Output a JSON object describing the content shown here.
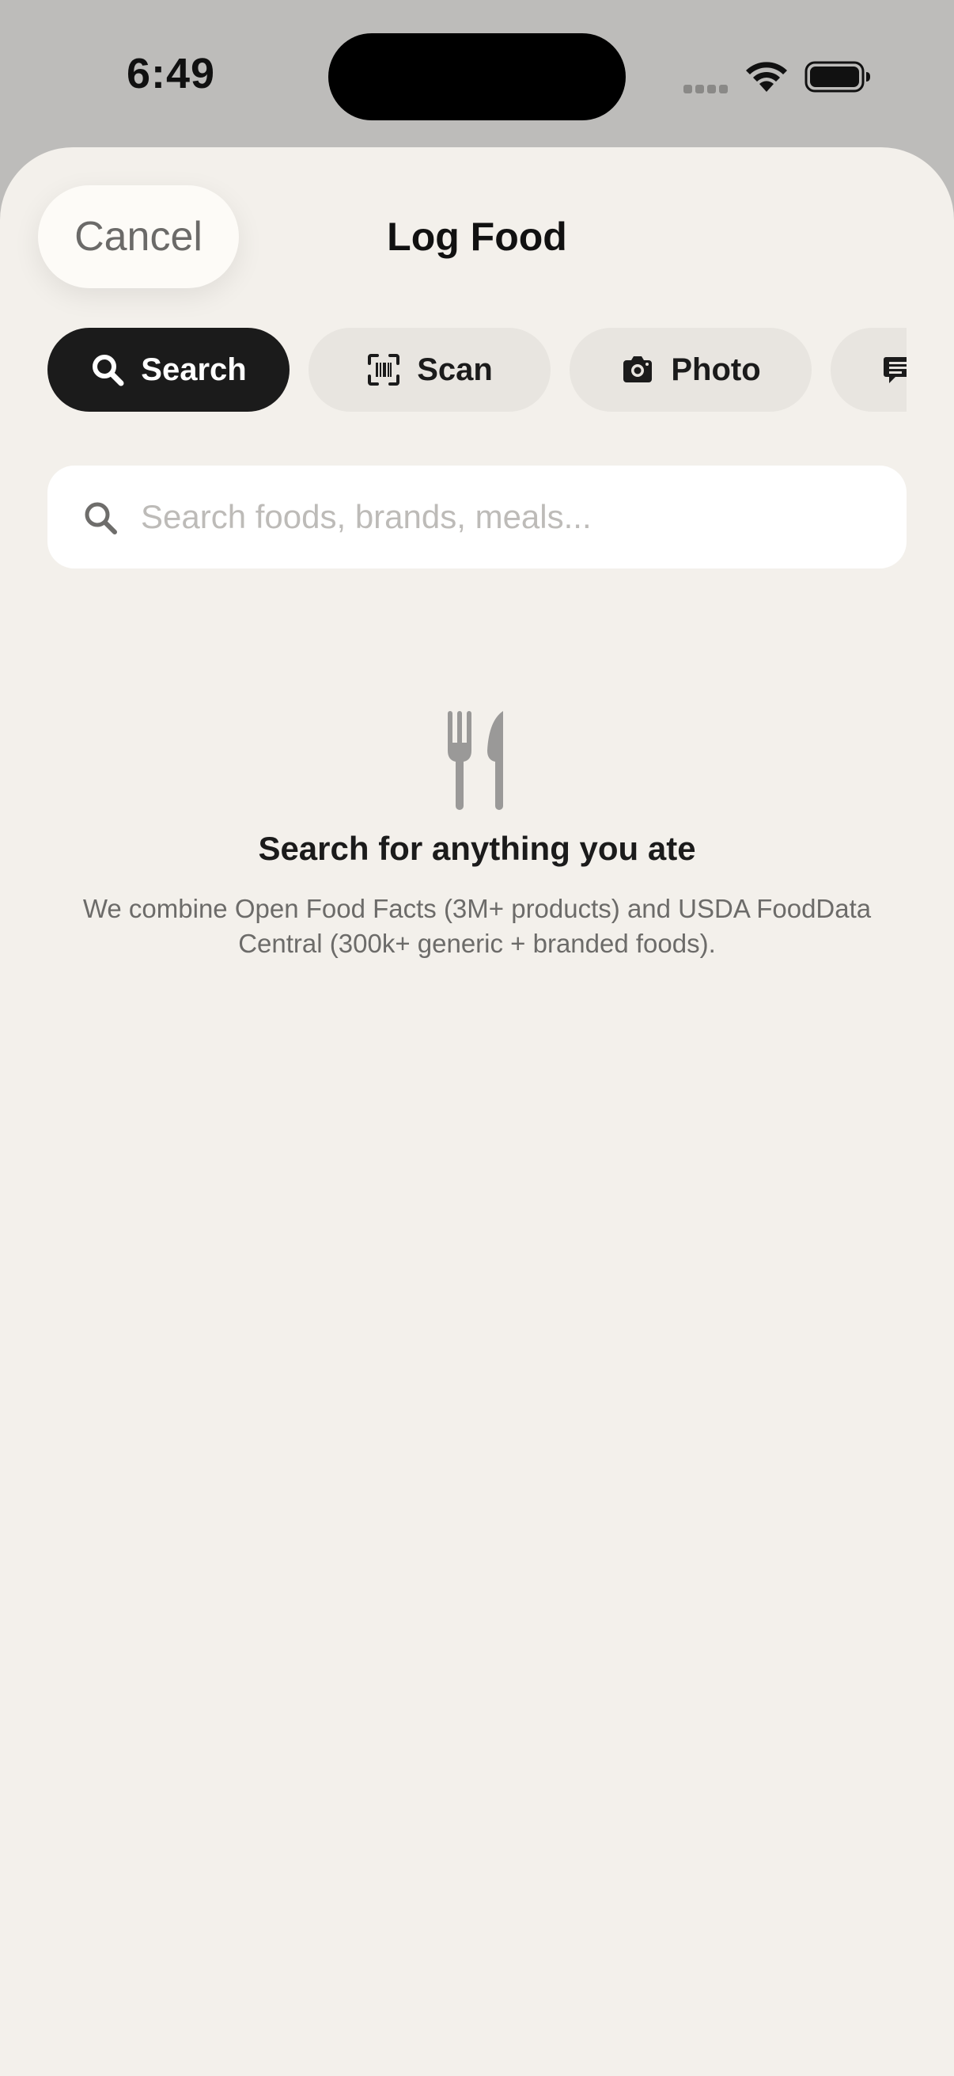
{
  "status_bar": {
    "time": "6:49"
  },
  "header": {
    "cancel_label": "Cancel",
    "title": "Log Food"
  },
  "tabs": [
    {
      "label": "Search",
      "icon": "search-icon",
      "active": true
    },
    {
      "label": "Scan",
      "icon": "barcode-scan-icon",
      "active": false
    },
    {
      "label": "Photo",
      "icon": "camera-icon",
      "active": false
    },
    {
      "label": "",
      "icon": "message-icon",
      "active": false
    }
  ],
  "search": {
    "placeholder": "Search foods, brands, meals...",
    "value": ""
  },
  "empty_state": {
    "icon": "fork-knife-icon",
    "title": "Search for anything you ate",
    "description": "We combine Open Food Facts (3M+ products) and USDA FoodData Central (300k+ generic + branded foods)."
  },
  "colors": {
    "sheet_background": "#f3f0eb",
    "active_tab": "#1b1b1b",
    "inactive_tab": "#e8e5e0"
  }
}
